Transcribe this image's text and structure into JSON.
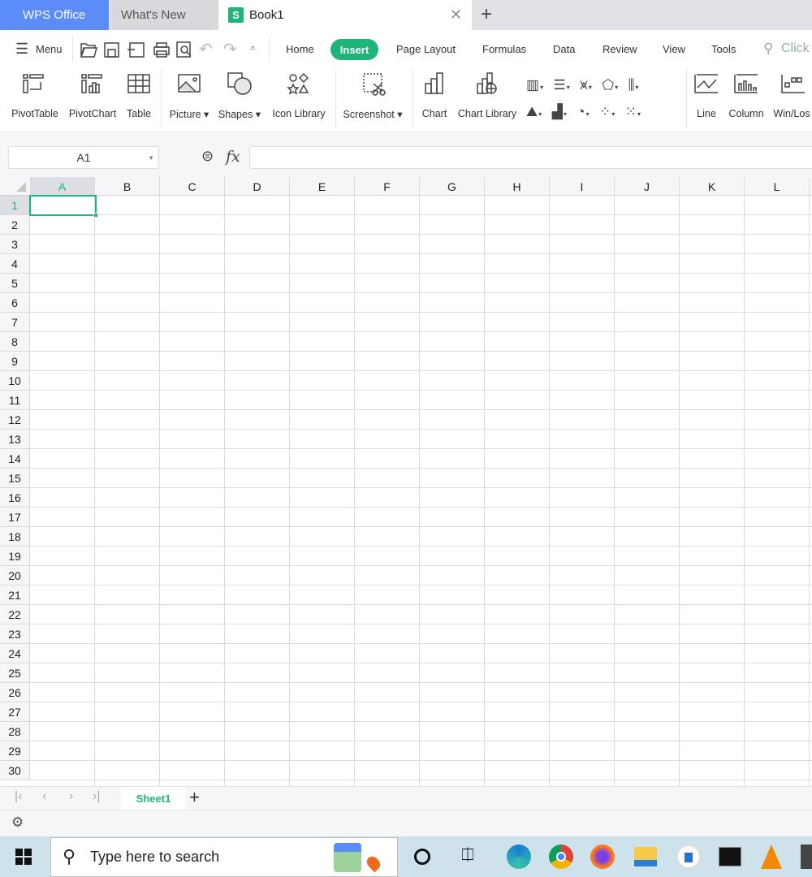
{
  "tabs": {
    "wps": "WPS Office",
    "whats_new": "What's New",
    "book": "Book1",
    "book_logo": "S"
  },
  "menu": {
    "menu_label": "Menu",
    "items": [
      "Home",
      "Insert",
      "Page Layout",
      "Formulas",
      "Data",
      "Review",
      "View",
      "Tools"
    ],
    "active": "Insert",
    "search_label": "Click"
  },
  "ribbon": {
    "pivot_table": "PivotTable",
    "pivot_chart": "PivotChart",
    "table": "Table",
    "picture": "Picture",
    "shapes": "Shapes",
    "icon_library": "Icon Library",
    "screenshot": "Screenshot",
    "chart": "Chart",
    "chart_library": "Chart Library",
    "line": "Line",
    "column": "Column",
    "win_loss": "Win/Los"
  },
  "formula_bar": {
    "name_box": "A1",
    "fx": "fx",
    "formula": ""
  },
  "grid": {
    "columns": [
      "A",
      "B",
      "C",
      "D",
      "E",
      "F",
      "G",
      "H",
      "I",
      "J",
      "K",
      "L"
    ],
    "rows": [
      1,
      2,
      3,
      4,
      5,
      6,
      7,
      8,
      9,
      10,
      11,
      12,
      13,
      14,
      15,
      16,
      17,
      18,
      19,
      20,
      21,
      22,
      23,
      24,
      25,
      26,
      27,
      28,
      29,
      30
    ],
    "selected_cell": "A1"
  },
  "sheets": {
    "tabs": [
      "Sheet1"
    ],
    "active": "Sheet1"
  },
  "taskbar": {
    "search_placeholder": "Type here to search",
    "apps": [
      "edge",
      "chrome",
      "firefox",
      "file-explorer",
      "app",
      "terminal",
      "vlc"
    ]
  },
  "colors": {
    "accent": "#1fb47a",
    "wps_tab": "#5b8cf7",
    "taskbar": "#cde2eb"
  }
}
